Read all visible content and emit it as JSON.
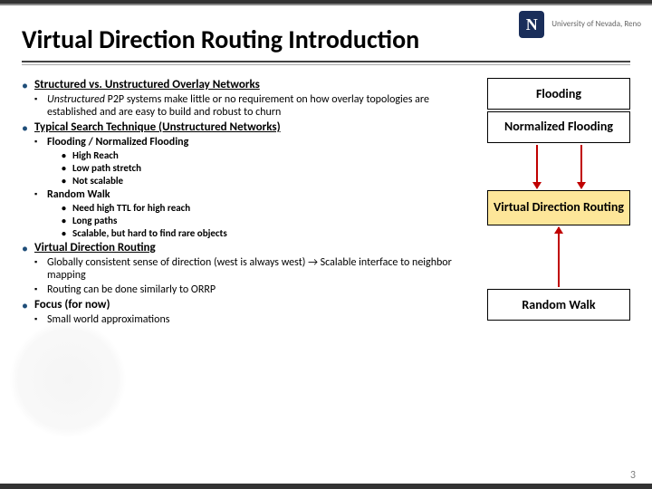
{
  "logo": {
    "letter": "N",
    "text": "University of Nevada, Reno"
  },
  "title": "Virtual Direction Routing Introduction",
  "b1": {
    "label": "Structured vs. Unstructured Overlay Networks",
    "sub1_prefix": "Unstructured",
    "sub1_rest": " P2P systems make little or no requirement on how overlay topologies are established and are easy to build and robust to churn"
  },
  "b2": {
    "label": "Typical Search Technique (Unstructured Networks)",
    "sub1": "Flooding / Normalized Flooding",
    "sub1_p1": "High Reach",
    "sub1_p2": "Low path stretch",
    "sub1_p3": "Not scalable",
    "sub2": "Random Walk",
    "sub2_p1": "Need high TTL for high reach",
    "sub2_p2": "Long paths",
    "sub2_p3": "Scalable, but hard to find rare objects"
  },
  "b3": {
    "label": "Virtual Direction Routing",
    "sub1_pre": "Globally consistent sense of direction (west is always west) ",
    "sub1_arrow": "→",
    "sub1_post": " Scalable interface to neighbor mapping",
    "sub2": "Routing can be done similarly to ORRP"
  },
  "b4": {
    "label": "Focus (for now)",
    "sub1": "Small world approximations"
  },
  "boxes": {
    "flooding": "Flooding",
    "normflooding": "Normalized Flooding",
    "vdr": "Virtual Direction Routing",
    "randomwalk": "Random Walk"
  },
  "page": "3"
}
